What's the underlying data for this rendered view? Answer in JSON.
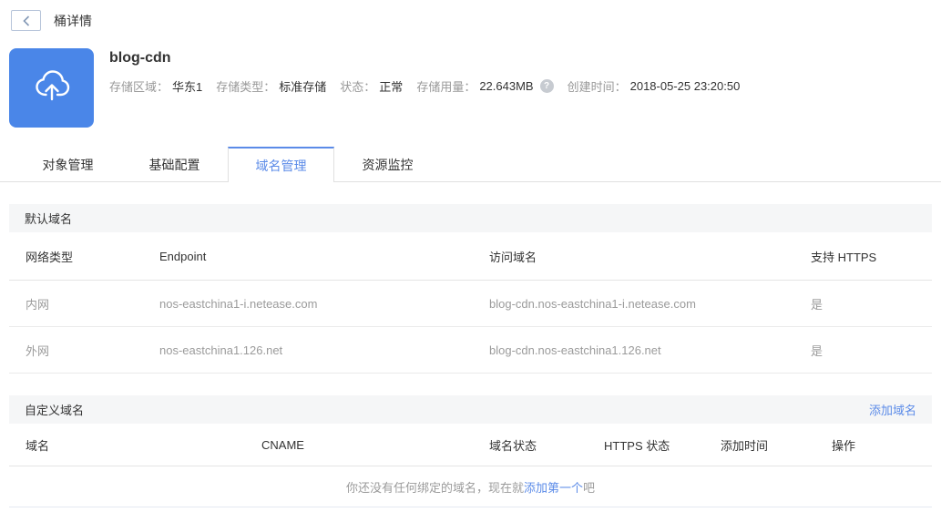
{
  "accent_color": "#5b8be8",
  "icon_color": "#4a86e8",
  "topbar": {
    "back_icon": "chevron-left",
    "title": "桶详情"
  },
  "bucket": {
    "name": "blog-cdn",
    "icon": "cloud-upload-icon",
    "meta": [
      {
        "label": "存储区域：",
        "value": "华东1"
      },
      {
        "label": "存储类型：",
        "value": "标准存储"
      },
      {
        "label": "状态：",
        "value": "正常"
      },
      {
        "label": "存储用量：",
        "value": "22.643MB",
        "help_icon": "?"
      },
      {
        "label": "创建时间：",
        "value": "2018-05-25 23:20:50"
      }
    ]
  },
  "tabs": [
    {
      "label": "对象管理",
      "active": false
    },
    {
      "label": "基础配置",
      "active": false
    },
    {
      "label": "域名管理",
      "active": true
    },
    {
      "label": "资源监控",
      "active": false
    }
  ],
  "default_domains": {
    "section_title": "默认域名",
    "columns": [
      "网络类型",
      "Endpoint",
      "访问域名",
      "支持 HTTPS"
    ],
    "rows": [
      [
        "内网",
        "nos-eastchina1-i.netease.com",
        "blog-cdn.nos-eastchina1-i.netease.com",
        "是"
      ],
      [
        "外网",
        "nos-eastchina1.126.net",
        "blog-cdn.nos-eastchina1.126.net",
        "是"
      ]
    ]
  },
  "custom_domains": {
    "section_title": "自定义域名",
    "add_link_label": "添加域名",
    "columns": [
      "域名",
      "CNAME",
      "域名状态",
      "HTTPS 状态",
      "添加时间",
      "操作"
    ],
    "empty_state": {
      "text_before": "你还没有任何绑定的域名，现在就",
      "link_label": "添加第一个",
      "text_after": "吧"
    }
  }
}
